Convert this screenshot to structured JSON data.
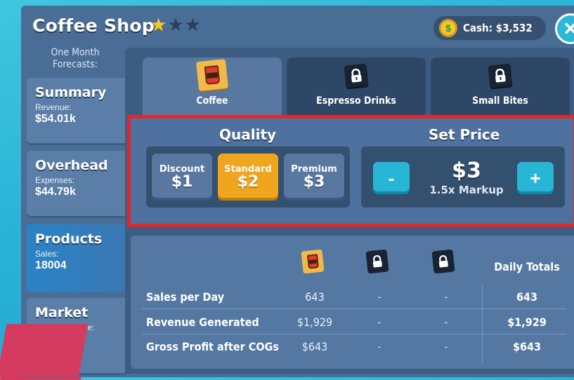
{
  "header": {
    "title": "Coffee Shop",
    "stars": {
      "filled": 1,
      "total": 3
    },
    "cash": "Cash: $3,532",
    "coin_symbol": "$"
  },
  "sidebar": {
    "forecast_label": "One Month Forecasts:",
    "cards": [
      {
        "title": "Summary",
        "sub": "Revenue:",
        "value": "$54.01k"
      },
      {
        "title": "Overhead",
        "sub": "Expenses:",
        "value": "$44.79k"
      },
      {
        "title": "Products",
        "sub": "Sales:",
        "value": "18004"
      },
      {
        "title": "Market",
        "sub": "ase:",
        "value": ""
      }
    ]
  },
  "tabs": [
    {
      "label": "Coffee",
      "icon": "coffee-cup-icon",
      "locked": false
    },
    {
      "label": "Espresso Drinks",
      "icon": "lock-icon",
      "locked": true
    },
    {
      "label": "Small Bites",
      "icon": "lock-icon",
      "locked": true
    }
  ],
  "quality": {
    "title": "Quality",
    "options": [
      {
        "name": "Discount",
        "price": "$1"
      },
      {
        "name": "Standard",
        "price": "$2"
      },
      {
        "name": "Premium",
        "price": "$3"
      }
    ],
    "selected": "Standard"
  },
  "price": {
    "title": "Set Price",
    "value": "$3",
    "markup": "1.5x Markup",
    "minus": "-",
    "plus": "+"
  },
  "table": {
    "daily_totals_label": "Daily Totals",
    "rows": [
      {
        "label": "Sales per Day",
        "coffee": "643",
        "espresso": "-",
        "bites": "-",
        "total": "643"
      },
      {
        "label": "Revenue Generated",
        "coffee": "$1,929",
        "espresso": "-",
        "bites": "-",
        "total": "$1,929"
      },
      {
        "label": "Gross Profit after COGs",
        "coffee": "$643",
        "espresso": "-",
        "bites": "-",
        "total": "$643"
      }
    ]
  },
  "colors": {
    "accent_orange": "#f0a51e",
    "accent_cyan": "#27b6d6",
    "highlight_red": "#e3262c",
    "panel_blue": "#4a6d96"
  }
}
